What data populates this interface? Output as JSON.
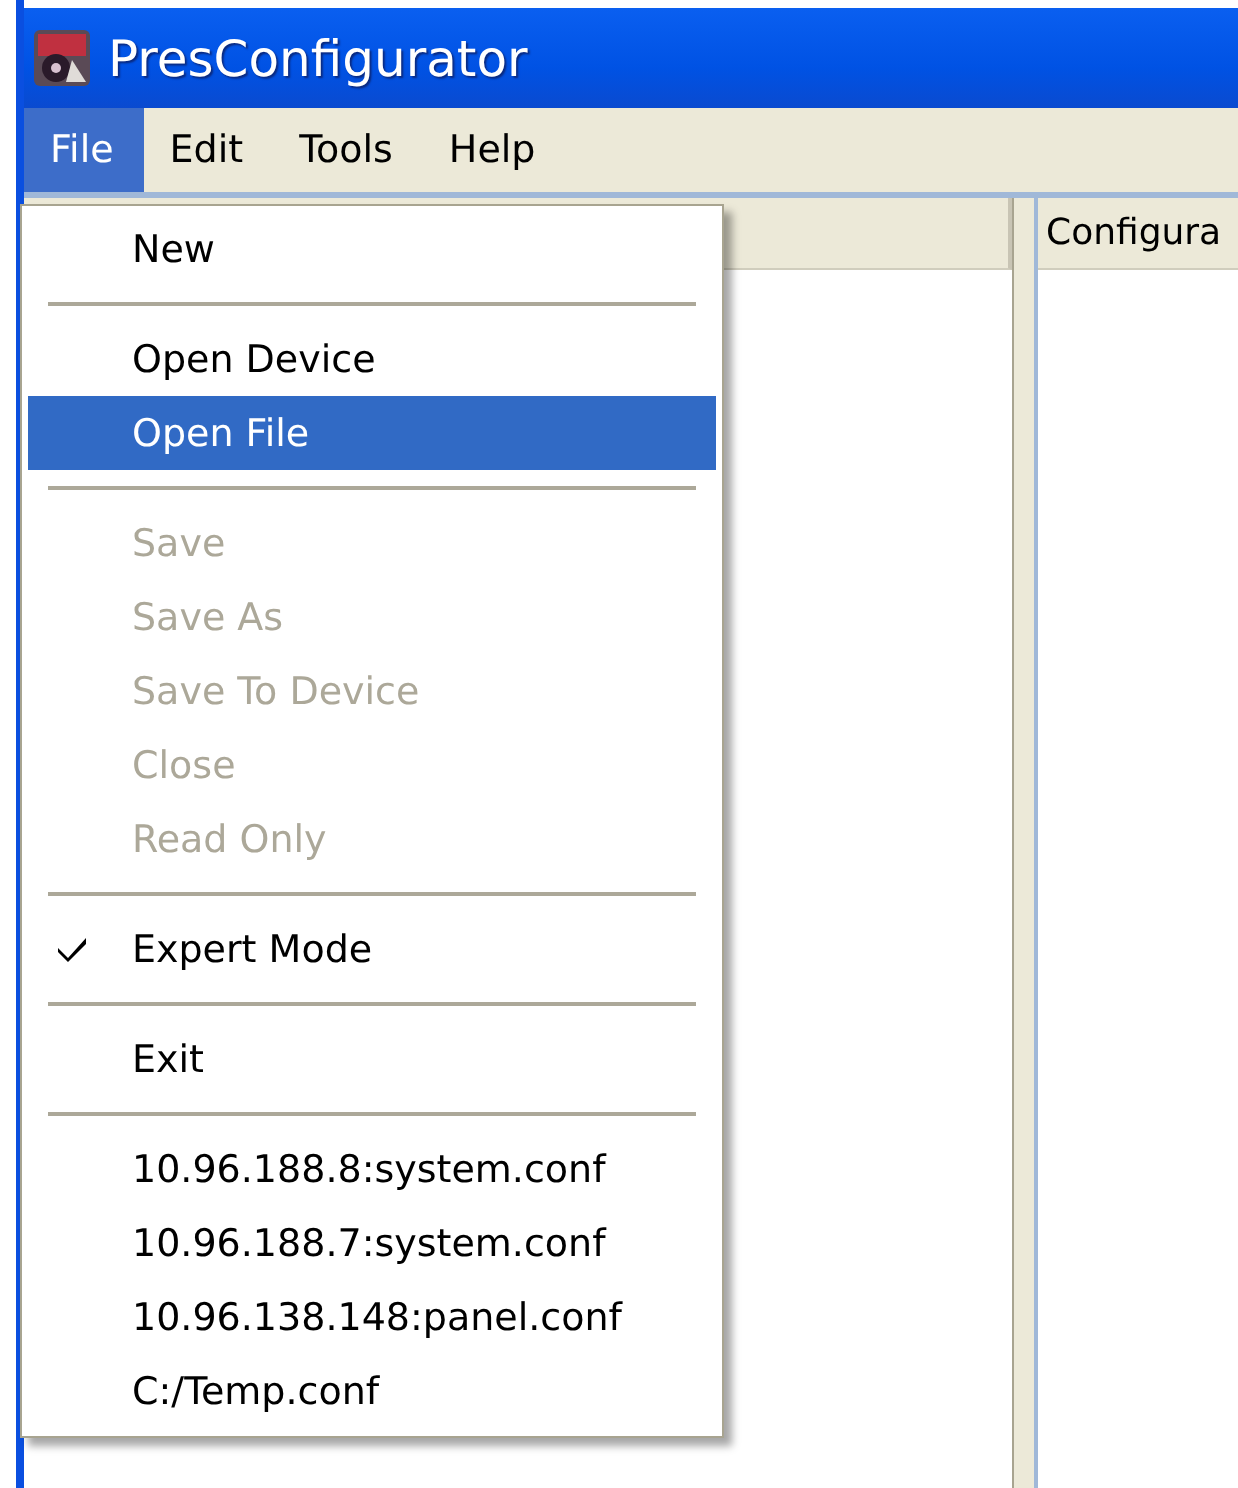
{
  "window": {
    "title": "PresConfigurator"
  },
  "menubar": [
    {
      "label": "File",
      "selected": true
    },
    {
      "label": "Edit",
      "selected": false
    },
    {
      "label": "Tools",
      "selected": false
    },
    {
      "label": "Help",
      "selected": false
    }
  ],
  "panes": {
    "right_header": "Configura"
  },
  "file_menu": [
    {
      "kind": "item",
      "label": "New",
      "disabled": false,
      "selected": false
    },
    {
      "kind": "separator"
    },
    {
      "kind": "item",
      "label": "Open Device",
      "disabled": false,
      "selected": false
    },
    {
      "kind": "item",
      "label": "Open File",
      "disabled": false,
      "selected": true
    },
    {
      "kind": "separator"
    },
    {
      "kind": "item",
      "label": "Save",
      "disabled": true,
      "selected": false
    },
    {
      "kind": "item",
      "label": "Save As",
      "disabled": true,
      "selected": false
    },
    {
      "kind": "item",
      "label": "Save To Device",
      "disabled": true,
      "selected": false
    },
    {
      "kind": "item",
      "label": "Close",
      "disabled": true,
      "selected": false
    },
    {
      "kind": "item",
      "label": "Read Only",
      "disabled": true,
      "selected": false
    },
    {
      "kind": "separator"
    },
    {
      "kind": "check",
      "label": "Expert Mode",
      "checked": true,
      "disabled": false,
      "selected": false
    },
    {
      "kind": "separator"
    },
    {
      "kind": "item",
      "label": "Exit",
      "disabled": false,
      "selected": false
    },
    {
      "kind": "separator"
    },
    {
      "kind": "item",
      "label": "10.96.188.8:system.conf",
      "disabled": false,
      "selected": false
    },
    {
      "kind": "item",
      "label": "10.96.188.7:system.conf",
      "disabled": false,
      "selected": false
    },
    {
      "kind": "item",
      "label": "10.96.138.148:panel.conf",
      "disabled": false,
      "selected": false
    },
    {
      "kind": "item",
      "label": "C:/Temp.conf",
      "disabled": false,
      "selected": false
    }
  ]
}
